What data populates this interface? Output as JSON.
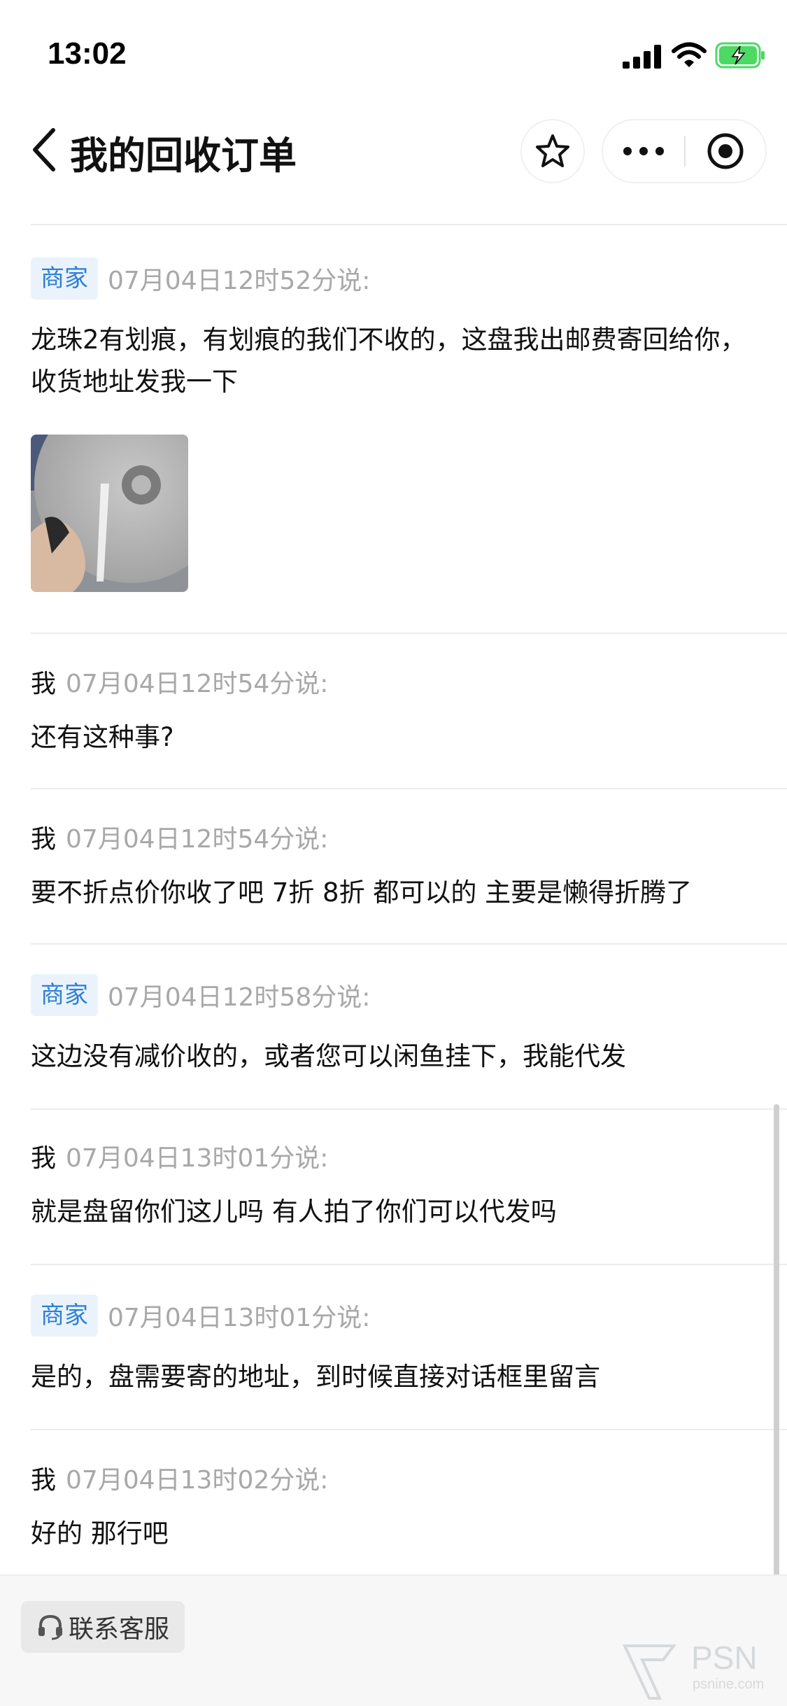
{
  "status_bar": {
    "time": "13:02"
  },
  "nav": {
    "title": "我的回收订单"
  },
  "messages": [
    {
      "sender": "商家",
      "role": "merchant",
      "timestamp": "07月04日12时52分说:",
      "text": "龙珠2有划痕，有划痕的我们不收的，这盘我出邮费寄回给你，收货地址发我一下",
      "has_image": true
    },
    {
      "sender": "我",
      "role": "me",
      "timestamp": "07月04日12时54分说:",
      "text": "还有这种事?"
    },
    {
      "sender": "我",
      "role": "me",
      "timestamp": "07月04日12时54分说:",
      "text": "要不折点价你收了吧 7折 8折 都可以的 主要是懒得折腾了"
    },
    {
      "sender": "商家",
      "role": "merchant",
      "timestamp": "07月04日12时58分说:",
      "text": "这边没有减价收的，或者您可以闲鱼挂下，我能代发"
    },
    {
      "sender": "我",
      "role": "me",
      "timestamp": "07月04日13时01分说:",
      "text": "就是盘留你们这儿吗 有人拍了你们可以代发吗"
    },
    {
      "sender": "商家",
      "role": "merchant",
      "timestamp": "07月04日13时01分说:",
      "text": "是的，盘需要寄的地址，到时候直接对话框里留言"
    },
    {
      "sender": "我",
      "role": "me",
      "timestamp": "07月04日13时02分说:",
      "text": "好的 那行吧"
    }
  ],
  "footer": {
    "contact_label": "联系客服"
  },
  "watermark": {
    "brand": "PSN",
    "site": "psnine.com"
  },
  "colors": {
    "badge_bg": "#eaf3fc",
    "badge_text": "#2e7fd6",
    "timestamp": "#a8a8a8",
    "battery": "#4cd964"
  },
  "icons": [
    "back-chevron-icon",
    "star-icon",
    "more-dots-icon",
    "close-target-icon",
    "headset-icon",
    "signal-icon",
    "wifi-icon",
    "battery-charging-icon"
  ]
}
